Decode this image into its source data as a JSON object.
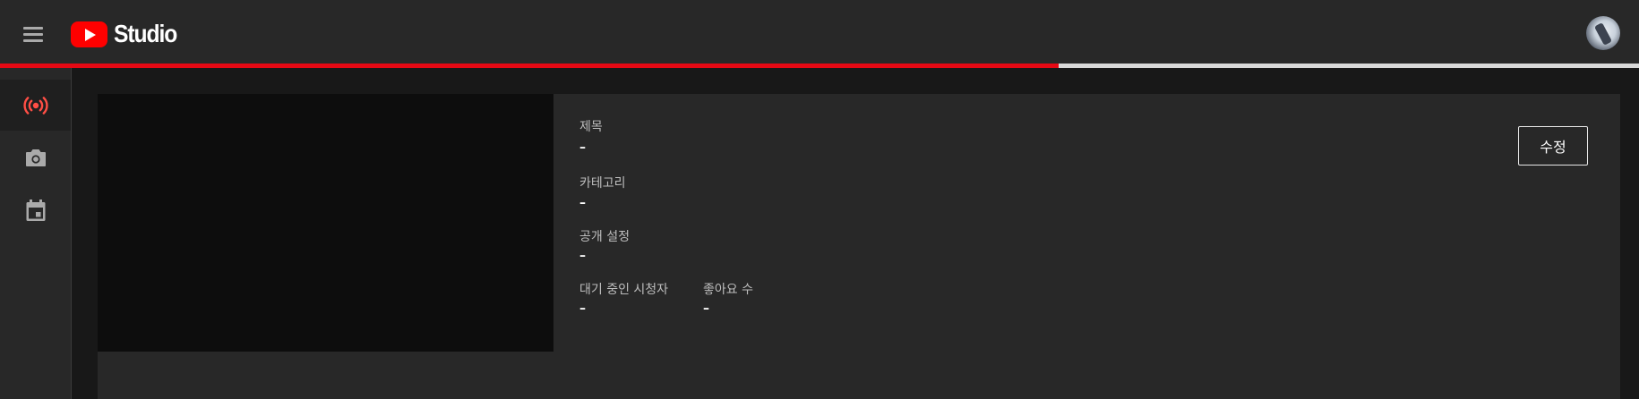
{
  "app": {
    "logo_text": "Studio"
  },
  "header": {
    "menu_icon": "hamburger-menu-icon",
    "avatar_icon": "user-avatar"
  },
  "progress": {
    "fraction": 0.646,
    "fill_color": "#e50914",
    "track_color": "#d9d9d9"
  },
  "sidebar": {
    "items": [
      {
        "icon": "live-broadcast-icon",
        "active": true,
        "color": "#ff4e45"
      },
      {
        "icon": "camera-icon",
        "active": false,
        "color": "#aaaaaa"
      },
      {
        "icon": "calendar-event-icon",
        "active": false,
        "color": "#aaaaaa"
      }
    ]
  },
  "details": {
    "title_label": "제목",
    "title_value": "–",
    "category_label": "카테고리",
    "category_value": "–",
    "visibility_label": "공개 설정",
    "visibility_value": "–",
    "waiting_label": "대기 중인 시청자",
    "waiting_value": "–",
    "likes_label": "좋아요 수",
    "likes_value": "–"
  },
  "actions": {
    "edit_label": "수정"
  },
  "colors": {
    "accent": "#ff0000",
    "header_bg": "#282828",
    "page_bg": "#181818"
  }
}
